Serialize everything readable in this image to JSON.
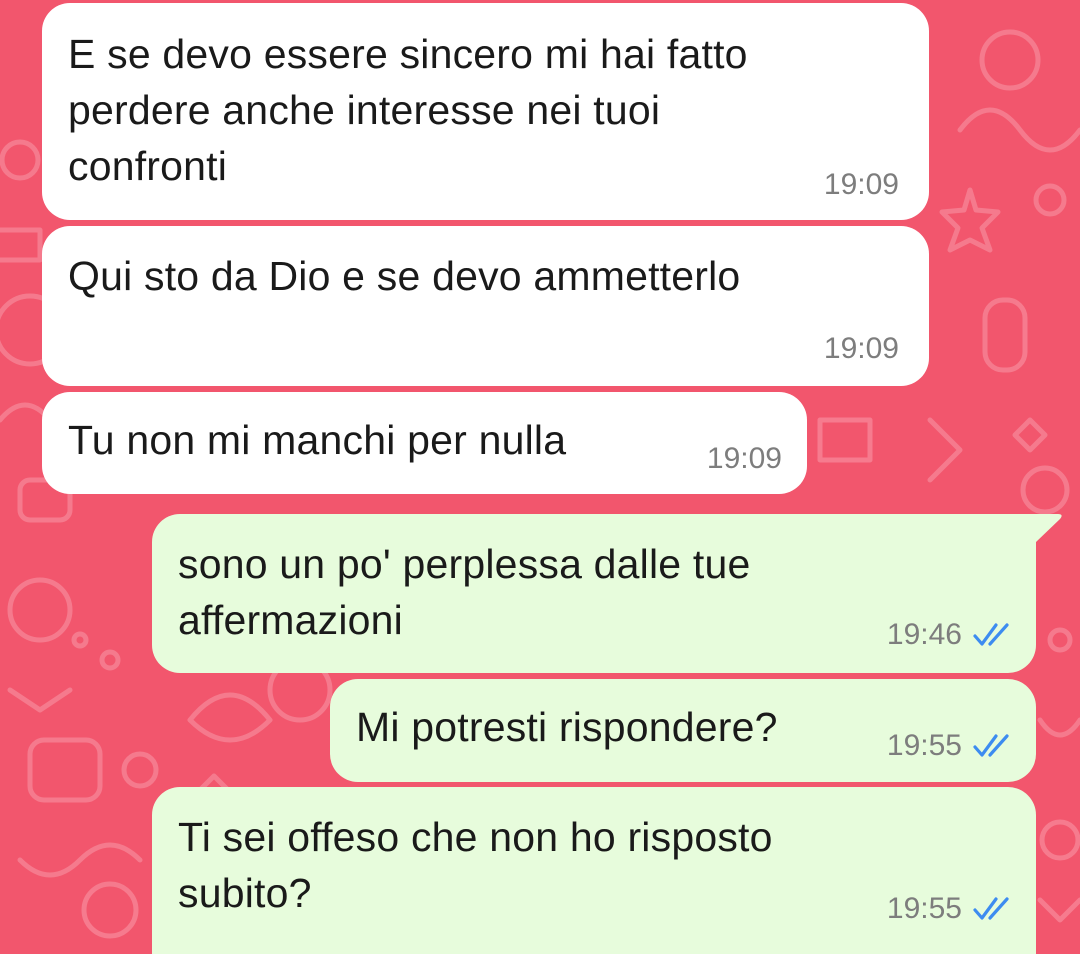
{
  "theme": {
    "wallpaper_color": "#f2566d",
    "incoming_bubble_color": "#ffffff",
    "outgoing_bubble_color": "#e7fcdc",
    "read_ticks_color": "#3d8cf0",
    "read_ticks_icon": "double-check-icon"
  },
  "messages": [
    {
      "direction": "incoming",
      "text": "E se devo essere sincero mi hai fatto\nperdere anche interesse nei tuoi\nconfronti",
      "time": "19:09"
    },
    {
      "direction": "incoming",
      "text": "Qui sto da Dio e se devo ammetterlo",
      "time": "19:09"
    },
    {
      "direction": "incoming",
      "text": "Tu non mi manchi per nulla",
      "time": "19:09"
    },
    {
      "direction": "outgoing",
      "text": "sono un po' perplessa dalle tue\naffermazioni",
      "time": "19:46",
      "status": "read"
    },
    {
      "direction": "outgoing",
      "text": "Mi potresti rispondere?",
      "time": "19:55",
      "status": "read"
    },
    {
      "direction": "outgoing",
      "text": "Ti sei offeso che non ho risposto\nsubito?",
      "time": "19:55",
      "status": "read"
    }
  ]
}
